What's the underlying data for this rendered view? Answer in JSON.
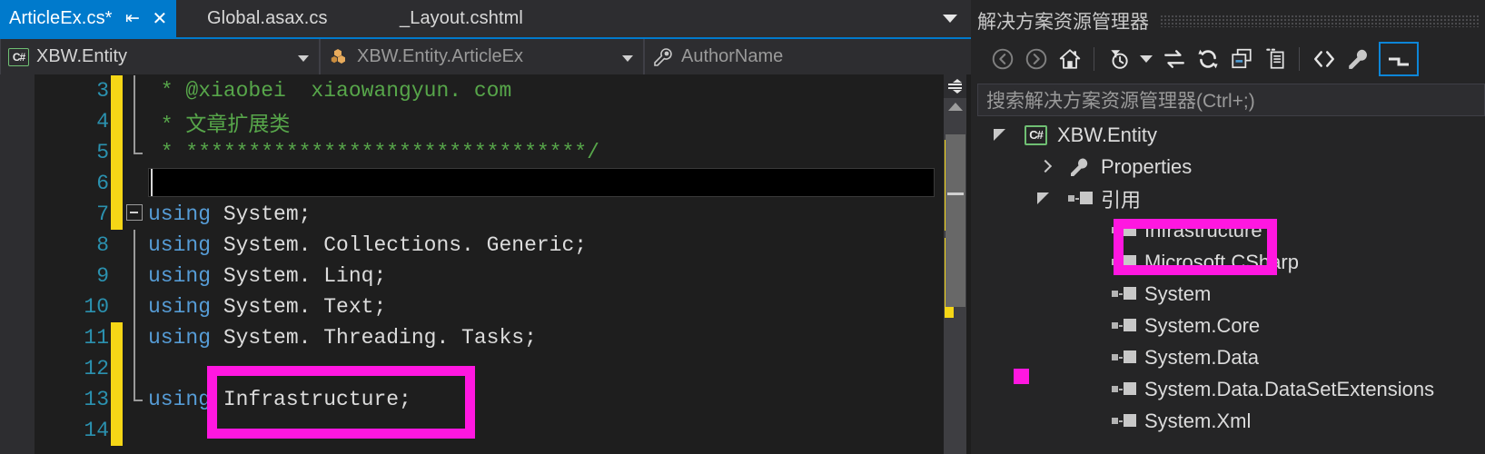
{
  "editor": {
    "tabs": [
      {
        "label": "ArticleEx.cs*",
        "active": true,
        "pin_icon": "pin-icon",
        "close_icon": "close-icon"
      },
      {
        "label": "Global.asax.cs",
        "active": false
      },
      {
        "label": "_Layout.cshtml",
        "active": false
      }
    ],
    "tab_overflow_icon": "chevron-down-icon",
    "navbar": {
      "project": {
        "label": "XBW.Entity",
        "icon": "csharp-project-icon"
      },
      "type": {
        "label": "XBW.Entity.ArticleEx",
        "icon": "class-icon"
      },
      "member": {
        "label": "AuthorName",
        "icon": "property-wrench-icon"
      }
    },
    "lines": [
      {
        "num": "3",
        "change": "yellow",
        "fold": "bar",
        "text": " * @xiaobei  xiaowangyun. com",
        "style": "comment"
      },
      {
        "num": "4",
        "change": "yellow",
        "fold": "bar",
        "text": " * 文章扩展类",
        "style": "comment"
      },
      {
        "num": "5",
        "change": "yellow",
        "fold": "elbow",
        "text": " * ********************************/",
        "style": "comment"
      },
      {
        "num": "6",
        "change": "yellow",
        "fold": "none",
        "text": "",
        "style": "plain"
      },
      {
        "num": "7",
        "change": "yellow",
        "fold": "boxminus",
        "text": "using System;",
        "style": "using"
      },
      {
        "num": "8",
        "change": "none",
        "fold": "bar",
        "text": "using System. Collections. Generic;",
        "style": "using"
      },
      {
        "num": "9",
        "change": "none",
        "fold": "bar",
        "text": "using System. Linq;",
        "style": "using"
      },
      {
        "num": "10",
        "change": "none",
        "fold": "bar",
        "text": "using System. Text;",
        "style": "using"
      },
      {
        "num": "11",
        "change": "yellow",
        "fold": "bar",
        "text": "using System. Threading. Tasks;",
        "style": "using"
      },
      {
        "num": "12",
        "change": "yellow",
        "fold": "bar",
        "text": "",
        "style": "plain"
      },
      {
        "num": "13",
        "change": "yellow",
        "fold": "elbow",
        "text": "using Infrastructure;",
        "style": "using"
      },
      {
        "num": "14",
        "change": "yellow",
        "fold": "none",
        "text": "",
        "style": "plain"
      }
    ],
    "keyword": "using",
    "scrollbar": {
      "split_icon": "split-view-icon",
      "up_arrow_icon": "scroll-up-arrow-icon"
    }
  },
  "solution_explorer": {
    "title": "解决方案资源管理器",
    "toolbar": [
      {
        "name": "back-icon"
      },
      {
        "name": "forward-icon"
      },
      {
        "name": "home-icon"
      },
      {
        "name": "pending-changes-filter-icon"
      },
      {
        "name": "filter-dropdown-chevron-icon"
      },
      {
        "name": "sync-with-active-document-icon"
      },
      {
        "name": "refresh-icon"
      },
      {
        "name": "collapse-all-icon"
      },
      {
        "name": "show-all-files-icon"
      },
      {
        "name": "view-code-icon"
      },
      {
        "name": "properties-wrench-icon"
      },
      {
        "name": "collapse-pane-icon"
      }
    ],
    "search_placeholder": "搜索解决方案资源管理器(Ctrl+;)",
    "tree": [
      {
        "label": "XBW.Entity",
        "indent": 0,
        "twisty": "expanded",
        "icon": "csharp-project-icon"
      },
      {
        "label": "Properties",
        "indent": 1,
        "twisty": "collapsed",
        "icon": "properties-wrench-icon"
      },
      {
        "label": "引用",
        "indent": 1,
        "twisty": "expanded",
        "icon": "reference-icon"
      },
      {
        "label": "Infrastructure",
        "indent": 2,
        "twisty": "none",
        "icon": "reference-icon"
      },
      {
        "label": "Microsoft.CSharp",
        "indent": 2,
        "twisty": "none",
        "icon": "reference-icon"
      },
      {
        "label": "System",
        "indent": 2,
        "twisty": "none",
        "icon": "reference-icon"
      },
      {
        "label": "System.Core",
        "indent": 2,
        "twisty": "none",
        "icon": "reference-icon"
      },
      {
        "label": "System.Data",
        "indent": 2,
        "twisty": "none",
        "icon": "reference-icon"
      },
      {
        "label": "System.Data.DataSetExtensions",
        "indent": 2,
        "twisty": "none",
        "icon": "reference-icon"
      },
      {
        "label": "System.Xml",
        "indent": 2,
        "twisty": "none",
        "icon": "reference-icon"
      }
    ]
  },
  "annotations": {
    "color": "#ff17e0",
    "boxes": [
      {
        "name": "highlight-code-infrastructure"
      },
      {
        "name": "highlight-tree-infrastructure"
      },
      {
        "name": "highlight-marker-square"
      }
    ]
  },
  "colors": {
    "accent_blue": "#007acc",
    "annotation_magenta": "#ff17e0",
    "change_bar_yellow": "#f5d616",
    "comment_green": "#57a64a",
    "keyword_blue": "#569cd6",
    "linenumber_teal": "#2b91af",
    "editor_bg": "#1e1e1e",
    "panel_bg": "#252526"
  }
}
